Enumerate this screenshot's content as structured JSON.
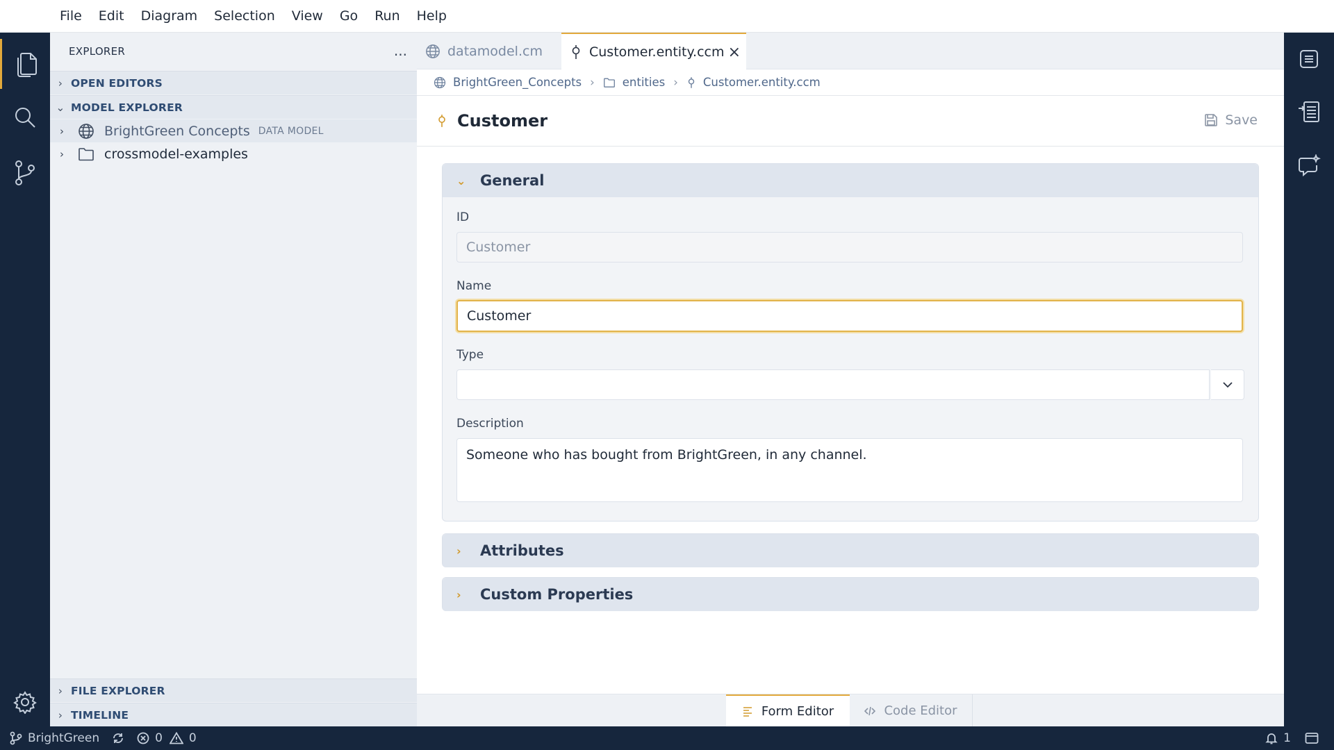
{
  "menu": {
    "items": [
      "File",
      "Edit",
      "Diagram",
      "Selection",
      "View",
      "Go",
      "Run",
      "Help"
    ]
  },
  "sidebar": {
    "title": "EXPLORER",
    "more_label": "...",
    "sections": {
      "open_editors": "OPEN EDITORS",
      "model_explorer": "MODEL EXPLORER",
      "file_explorer": "FILE EXPLORER",
      "timeline": "TIMELINE"
    },
    "tree": {
      "item1_label": "BrightGreen Concepts",
      "item1_badge": "DATA MODEL",
      "item2_label": "crossmodel-examples"
    }
  },
  "tabs": {
    "tab1": "datamodel.cm",
    "tab2": "Customer.entity.ccm"
  },
  "breadcrumb": {
    "part1": "BrightGreen_Concepts",
    "part2": "entities",
    "part3": "Customer.entity.ccm"
  },
  "form": {
    "title": "Customer",
    "save_label": "Save",
    "general": {
      "heading": "General",
      "id_label": "ID",
      "id_value": "Customer",
      "name_label": "Name",
      "name_value": "Customer",
      "type_label": "Type",
      "type_value": "",
      "description_label": "Description",
      "description_value": "Someone who has bought from BrightGreen, in any channel."
    },
    "attributes_heading": "Attributes",
    "custom_properties_heading": "Custom Properties"
  },
  "bottom_tabs": {
    "form_editor": "Form Editor",
    "code_editor": "Code Editor"
  },
  "status": {
    "branch": "BrightGreen",
    "errors": "0",
    "warnings": "0",
    "notifications": "1"
  },
  "colors": {
    "accent": "#e2a93b",
    "activity_bar": "#16263d",
    "sidebar_bg": "#eef1f5",
    "section_text": "#2f4c73"
  }
}
